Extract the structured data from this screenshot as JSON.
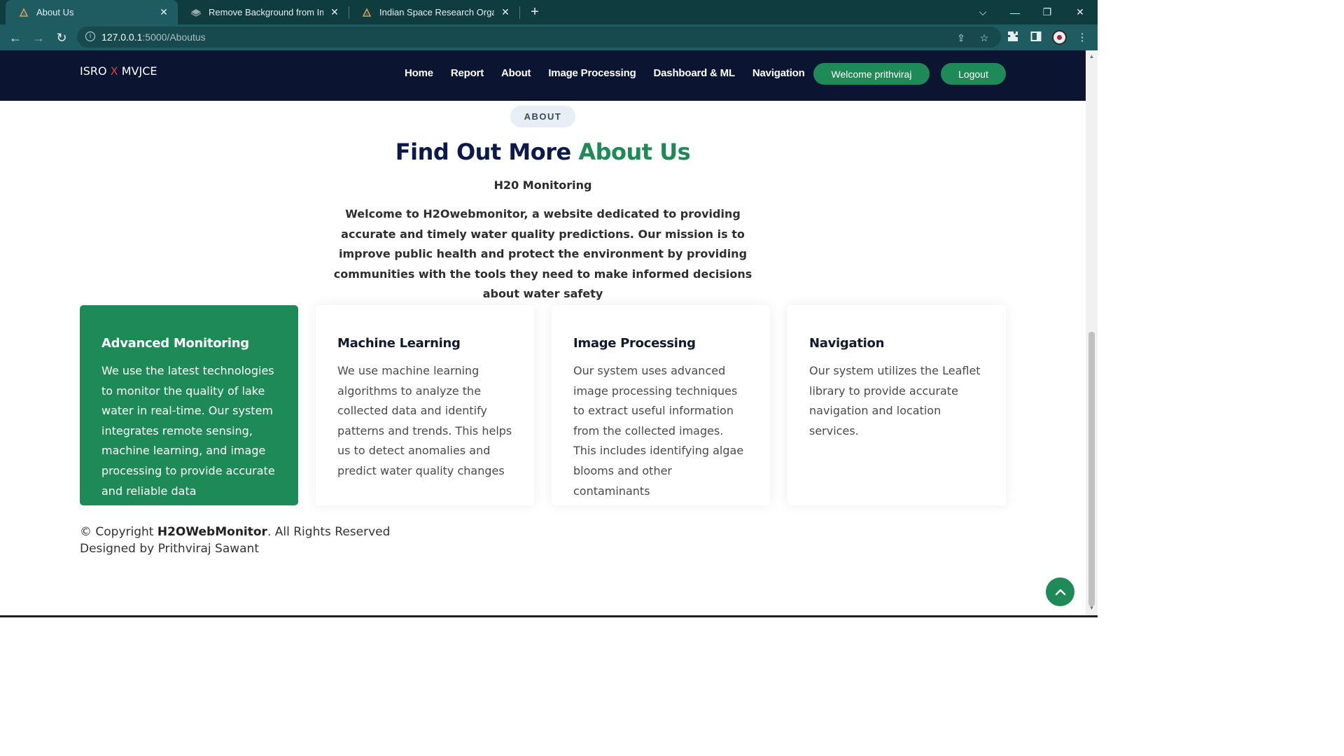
{
  "browser": {
    "tabs": [
      {
        "title": "About Us",
        "active": true
      },
      {
        "title": "Remove Background from Image",
        "active": false
      },
      {
        "title": "Indian Space Research Organisati",
        "active": false
      }
    ],
    "url_host": "127.0.0.1",
    "url_path": ":5000/Aboutus"
  },
  "site": {
    "logo_left": "ISRO ",
    "logo_x": "X",
    "logo_right": " MVJCE",
    "nav": [
      "Home",
      "Report",
      "About",
      "Image Processing",
      "Dashboard & ML",
      "Navigation"
    ],
    "welcome_button": "Welcome prithviraj",
    "logout_button": "Logout"
  },
  "about": {
    "badge": "ABOUT",
    "title_main": "Find Out More ",
    "title_accent": "About Us",
    "subheading": "H20 Monitoring",
    "lead": "Welcome to H2Owebmonitor, a website dedicated to providing accurate and timely water quality predictions. Our mission is to improve public health and protect the environment by providing communities with the tools they need to make informed decisions about water safety",
    "cards": [
      {
        "title": "Advanced Monitoring",
        "text": "We use the latest technologies to monitor the quality of lake water in real-time. Our system integrates remote sensing, machine learning, and image processing to provide accurate and reliable data"
      },
      {
        "title": "Machine Learning",
        "text": "We use machine learning algorithms to analyze the collected data and identify patterns and trends. This helps us to detect anomalies and predict water quality changes"
      },
      {
        "title": "Image Processing",
        "text": "Our system uses advanced image processing techniques to extract useful information from the collected images. This includes identifying algae blooms and other contaminants"
      },
      {
        "title": "Navigation",
        "text": "Our system utilizes the Leaflet library to provide accurate navigation and location services."
      }
    ]
  },
  "footer": {
    "copyright_prefix": "© Copyright ",
    "brand": "H2OWebMonitor",
    "copyright_suffix": ". All Rights Reserved",
    "designed_by": "Designed by Prithviraj Sawant"
  },
  "colors": {
    "accent": "#1e8a57",
    "header_bg": "#0b1532",
    "title_dark": "#0b1a4a",
    "browser_tabbar": "#0f3d3f"
  }
}
